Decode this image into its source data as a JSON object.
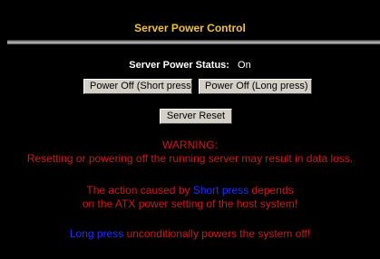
{
  "page": {
    "title": "Server Power Control"
  },
  "status": {
    "label": "Server Power Status:",
    "value": "On"
  },
  "buttons": {
    "short_press": "Power Off (Short press)",
    "long_press": "Power Off (Long press)",
    "reset": "Server Reset"
  },
  "warning": {
    "title": "WARNING:",
    "line1": "Resetting or powering off the running server may result in data loss.",
    "line2_before": "The action caused by ",
    "line2_keyword": "Short press",
    "line2_after": " depends",
    "line3": "on the ATX power setting of the host system!",
    "line4_keyword": "Long press",
    "line4_after": " unconditionally powers the system off!"
  },
  "colors": {
    "background": "#000000",
    "title": "#f0c040",
    "warning_text": "#cc1a1a",
    "keyword": "#1e2dff"
  }
}
